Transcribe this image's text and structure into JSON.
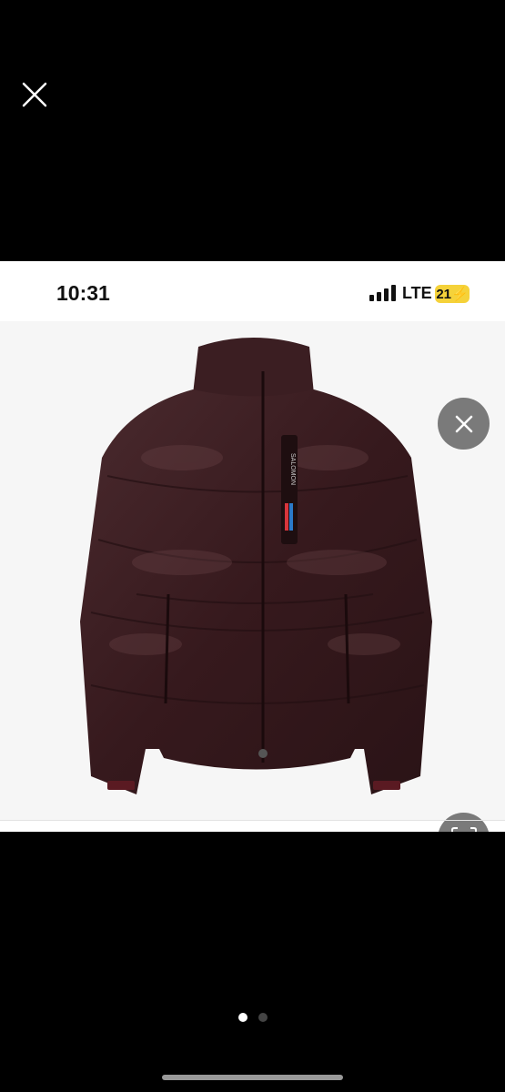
{
  "viewer": {
    "close_icon": "close-icon",
    "pagination": {
      "total": 2,
      "current": 1
    }
  },
  "screenshot": {
    "status_bar": {
      "time": "10:31",
      "network": "LTE",
      "battery": "21",
      "signal_icon": "cellular-signal-icon",
      "battery_icon": "battery-charging-icon"
    },
    "product_image": {
      "subject": "jacket-photo",
      "logo_text": "SALOMON"
    },
    "buttons": {
      "close_icon": "close-icon",
      "visual_search_icon": "visual-search-icon"
    },
    "colors": {
      "jacket": "#3a1e22",
      "button_bg": "#7a7a7a",
      "battery": "#f5d23a"
    }
  }
}
